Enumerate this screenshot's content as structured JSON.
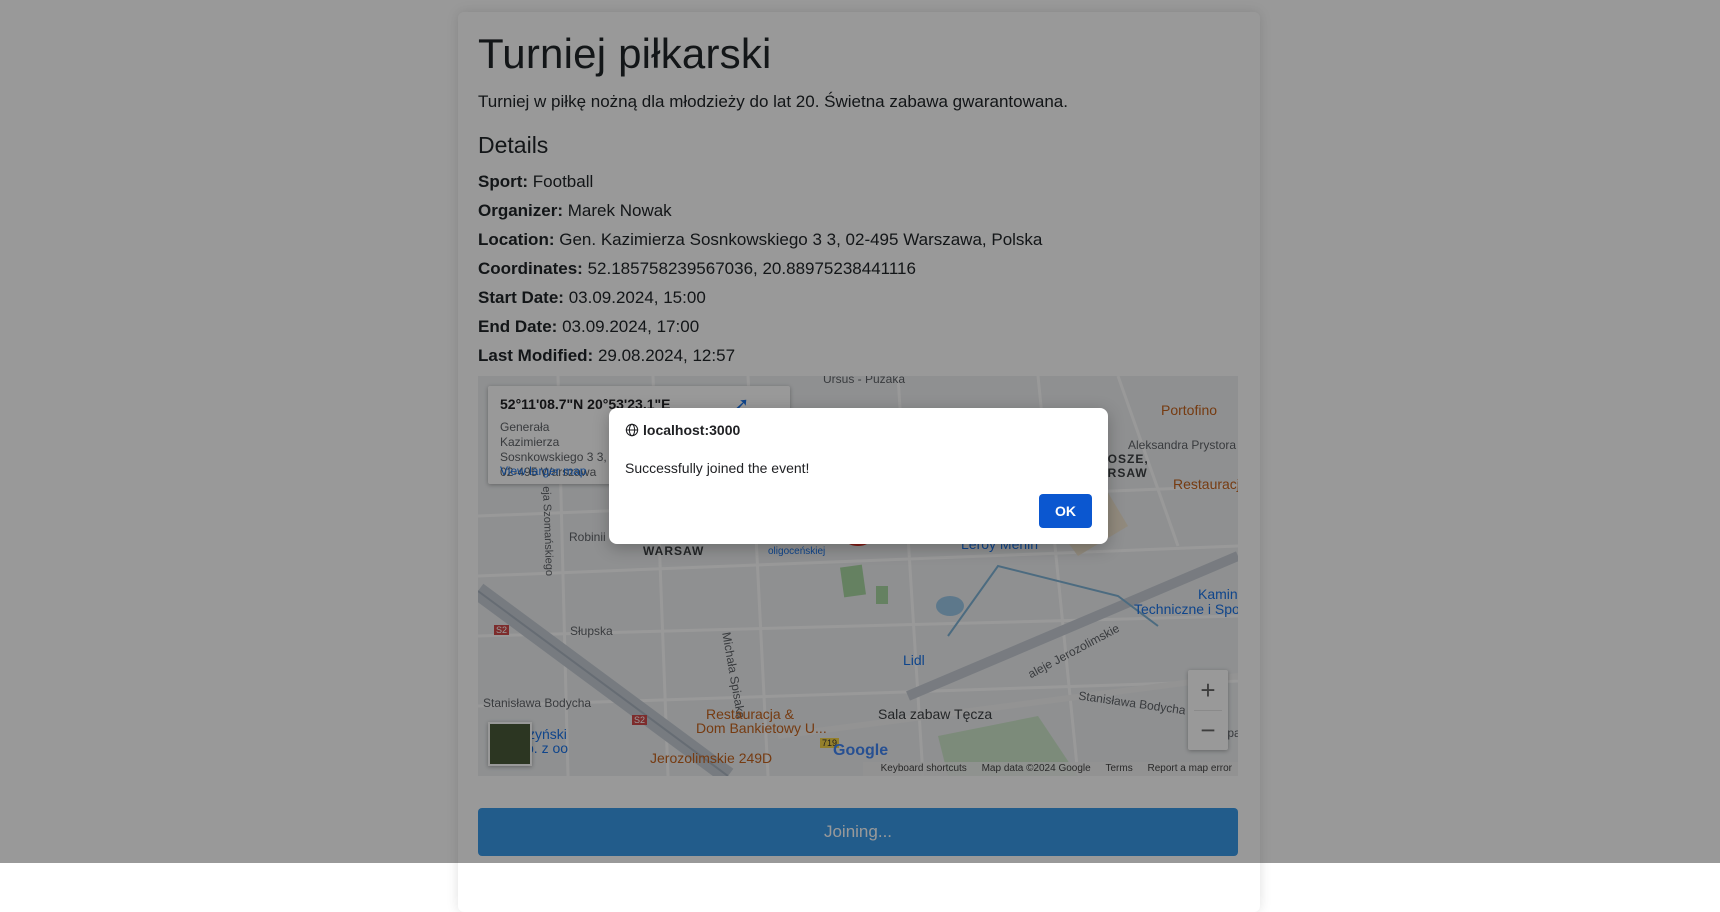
{
  "event": {
    "title": "Turniej piłkarski",
    "description": "Turniej w piłkę nożną dla młodzieży do lat 20. Świetna zabawa gwarantowana.",
    "details_heading": "Details",
    "details": [
      {
        "label": "Sport:",
        "value": "Football"
      },
      {
        "label": "Organizer:",
        "value": "Marek Nowak"
      },
      {
        "label": "Location:",
        "value": "Gen. Kazimierza Sosnkowskiego 3 3, 02-495 Warszawa, Polska"
      },
      {
        "label": "Coordinates:",
        "value": "52.185758239567036, 20.88975238441116"
      },
      {
        "label": "Start Date:",
        "value": "03.09.2024, 15:00"
      },
      {
        "label": "End Date:",
        "value": "03.09.2024, 17:00"
      },
      {
        "label": "Last Modified:",
        "value": "29.08.2024, 12:57"
      }
    ]
  },
  "map": {
    "info_coords": "52°11'08.7\"N 20°53'23.1\"E",
    "info_address": "Generała Kazimierza Sosnkowskiego 3 3, 02-495 Warszawa",
    "view_larger": "View larger map",
    "labels": {
      "ursus": "Ursus - Puzaka",
      "portofino": "Portofino",
      "aleksandra": "Aleksandra Prystora",
      "rosze": "ROSZE,",
      "arsaw": "ARSAW",
      "restauracja_right": "Restauracj",
      "robinii": "Robinii",
      "warsaw": "WARSAW",
      "szomanskiego": "eja Szomańskiego",
      "oligocenskiej": "oligoceńskiej",
      "leroy": "Leroy Merlin",
      "kamin": "Kamin",
      "techniczne": "Techniczne i Spo",
      "slupska": "Słupska",
      "michala": "Michała Spisaka",
      "aleje": "aleje Jerozolimskie",
      "lidl": "Lidl",
      "bodycha_left": "Stanisława Bodycha",
      "bodycha_right": "Stanisława Bodycha",
      "rest_dom": "Restauracja &",
      "rest_dom2": "Dom Bankietowy U...",
      "sala": "Sala zabaw Tęcza",
      "jerozolimskie249": "Jerozolimskie 249D",
      "zynski": "zyński",
      "pzoo": "p. z oo",
      "opa": "Opa",
      "s2a": "S2",
      "s2b": "S2",
      "r719": "719"
    },
    "google": "Google",
    "attribution": {
      "shortcuts": "Keyboard shortcuts",
      "data": "Map data ©2024 Google",
      "terms": "Terms",
      "report": "Report a map error"
    },
    "zoom_in": "+",
    "zoom_out": "−"
  },
  "join_button": "Joining...",
  "dialog": {
    "origin": "localhost:3000",
    "message": "Successfully joined the event!",
    "ok": "OK"
  }
}
